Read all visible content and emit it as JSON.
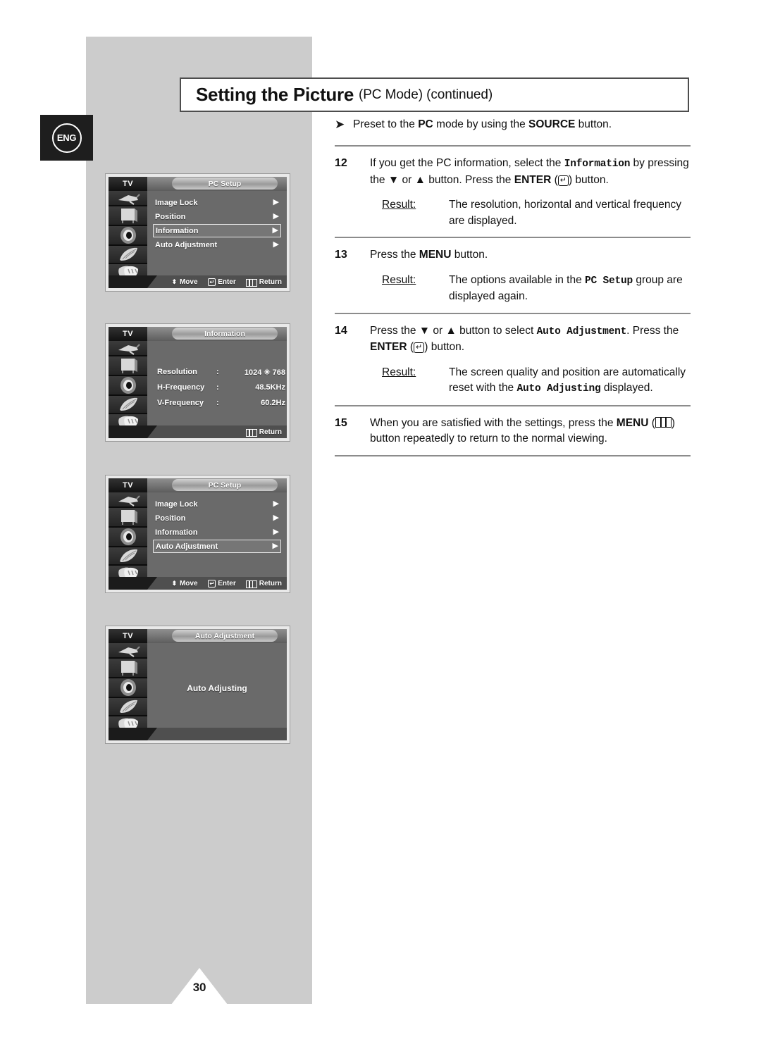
{
  "page": {
    "number": "30",
    "language_badge": "ENG"
  },
  "header": {
    "title_main": "Setting the Picture",
    "title_sub": "(PC Mode)  (continued)"
  },
  "preset_note": {
    "bullet": "➤",
    "text_parts": [
      "Preset to the ",
      "PC",
      " mode by using the ",
      "SOURCE",
      " button."
    ]
  },
  "steps": [
    {
      "number": "12",
      "text_parts": [
        "If you get the PC information, select the ",
        "Information",
        " by pressing the ▼ or ▲ button. Press the ",
        "ENTER",
        " (",
        ") button."
      ],
      "result_label": "Result:",
      "result_text": "The resolution, horizontal and vertical frequency are displayed."
    },
    {
      "number": "13",
      "text_parts": [
        "Press the ",
        "MENU",
        " button."
      ],
      "result_label": "Result:",
      "result_text_parts": [
        "The options available in the ",
        "PC Setup",
        " group are displayed again."
      ]
    },
    {
      "number": "14",
      "text_parts": [
        "Press the ▼ or ▲ button to select ",
        "Auto Adjustment",
        ". Press the ",
        "ENTER",
        " (",
        ") button."
      ],
      "result_label": "Result:",
      "result_text_parts": [
        "The screen quality and position are automatically reset with the ",
        "Auto Adjusting",
        " displayed."
      ]
    },
    {
      "number": "15",
      "text_parts": [
        "When you are satisfied with the settings, press the ",
        "MENU",
        " (",
        ") button repeatedly to return to the normal viewing."
      ]
    }
  ],
  "osd_screens": [
    {
      "device_label": "TV",
      "title": "PC Setup",
      "rows": [
        {
          "label": "Image Lock",
          "arrow": "▶",
          "selected": false
        },
        {
          "label": "Position",
          "arrow": "▶",
          "selected": false
        },
        {
          "label": "Information",
          "arrow": "▶",
          "selected": true
        },
        {
          "label": "Auto Adjustment",
          "arrow": "▶",
          "selected": false
        }
      ],
      "footer": [
        {
          "icon": "updown-arrow-icon",
          "label": "Move"
        },
        {
          "icon": "enter-icon",
          "label": "Enter"
        },
        {
          "icon": "return-icon",
          "label": "Return"
        }
      ]
    },
    {
      "device_label": "TV",
      "title": "Information",
      "info_rows": [
        {
          "key": "Resolution",
          "colon": ":",
          "value": "1024 ✳ 768"
        },
        {
          "key": "H-Frequency",
          "colon": ":",
          "value": "48.5KHz"
        },
        {
          "key": "V-Frequency",
          "colon": ":",
          "value": "60.2Hz"
        }
      ],
      "footer": [
        {
          "icon": "return-icon",
          "label": "Return"
        }
      ]
    },
    {
      "device_label": "TV",
      "title": "PC Setup",
      "rows": [
        {
          "label": "Image Lock",
          "arrow": "▶",
          "selected": false
        },
        {
          "label": "Position",
          "arrow": "▶",
          "selected": false
        },
        {
          "label": "Information",
          "arrow": "▶",
          "selected": false
        },
        {
          "label": "Auto Adjustment",
          "arrow": "▶",
          "selected": true
        }
      ],
      "footer": [
        {
          "icon": "updown-arrow-icon",
          "label": "Move"
        },
        {
          "icon": "enter-icon",
          "label": "Enter"
        },
        {
          "icon": "return-icon",
          "label": "Return"
        }
      ]
    },
    {
      "device_label": "TV",
      "title": "Auto Adjustment",
      "center_message": "Auto Adjusting",
      "footer": []
    }
  ],
  "rail_icons": [
    "antenna-icon",
    "tv-set-icon",
    "speaker-icon",
    "feather-icon",
    "theater-masks-icon"
  ],
  "colors": {
    "page_gray": "#cccccc",
    "osd_body": "#6a6a6a",
    "osd_rail": "#1b1b1b",
    "badge_dark": "#1e1e1e",
    "rule": "#8c8c8c"
  }
}
